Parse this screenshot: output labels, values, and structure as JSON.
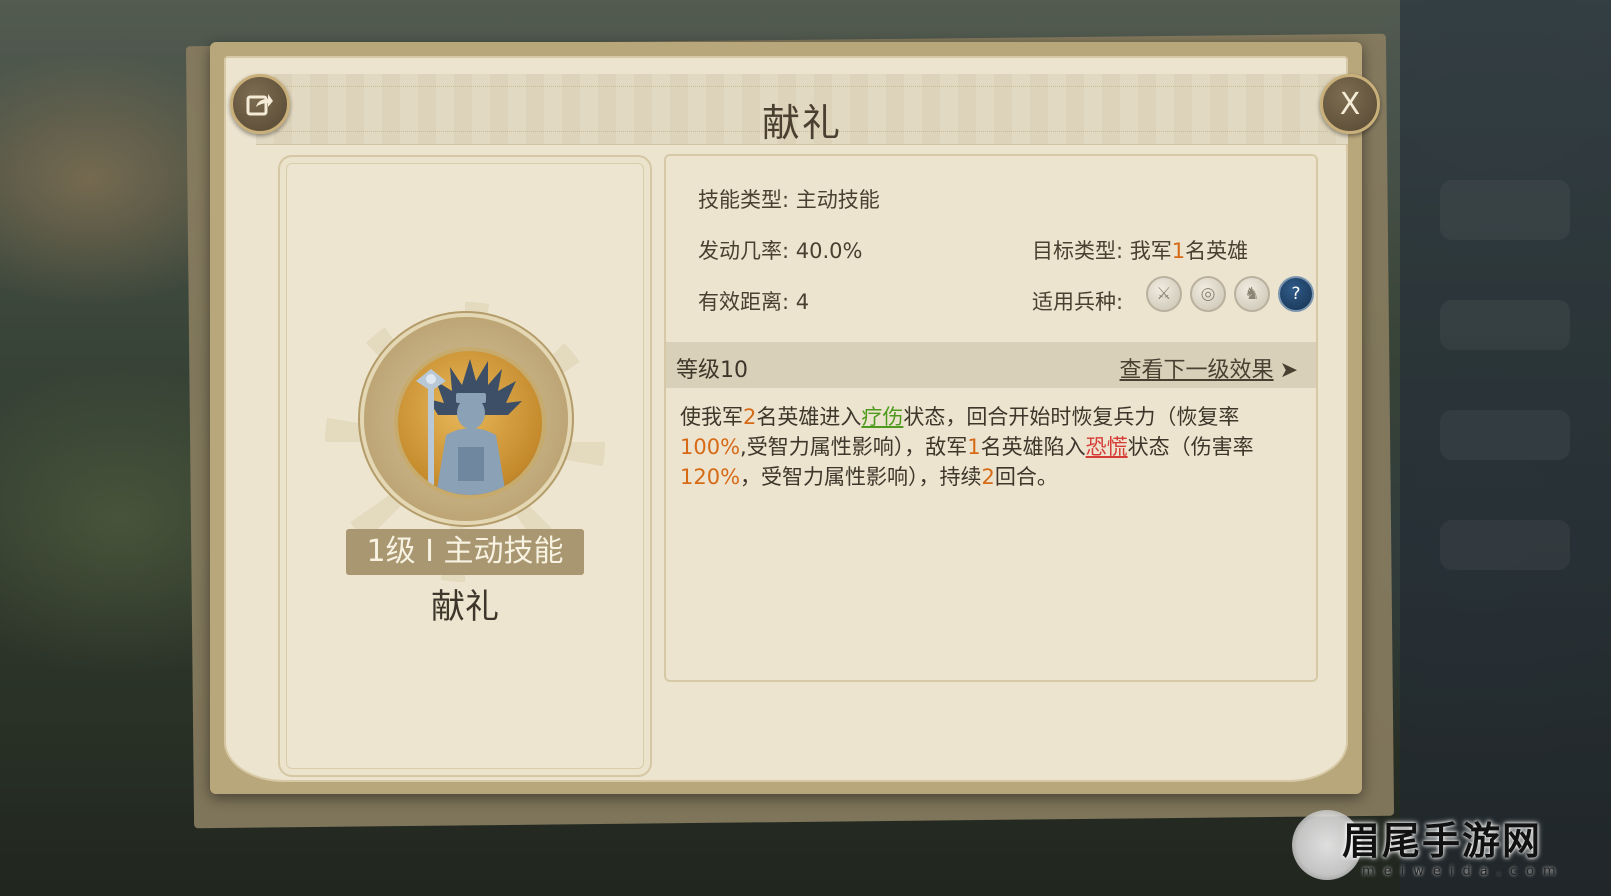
{
  "dialog": {
    "title": "献礼",
    "share_icon": "share-icon",
    "close_label": "X"
  },
  "skill_card": {
    "badge": "1级 I 主动技能",
    "name": "献礼"
  },
  "info": {
    "skill_type_label": "技能类型:",
    "skill_type_value": "主动技能",
    "trigger_rate_label": "发动几率:",
    "trigger_rate_value": "40.0%",
    "target_type_label": "目标类型:",
    "target_type_prefix": "我军",
    "target_type_count": "1",
    "target_type_suffix": "名英雄",
    "range_label": "有效距离:",
    "range_value": "4",
    "troop_label": "适用兵种:",
    "troop_icons": [
      "sword-icon",
      "target-icon",
      "horse-icon",
      "question-icon"
    ]
  },
  "level": {
    "label": "等级10",
    "next_link": "查看下一级效果"
  },
  "description": {
    "p1": "使我军",
    "n1": "2",
    "p2": "名英雄进入",
    "status1": "疗伤",
    "p3": "状态，回合开始时恢复兵力（恢复率",
    "n2": "100%",
    "p4": ",受智力属性影响），敌军",
    "n3": "1",
    "p5": "名英雄陷入",
    "status2": "恐慌",
    "p6": "状态（伤害率",
    "n4": "120%",
    "p7": "，受智力属性影响），持续",
    "n5": "2",
    "p8": "回合。"
  },
  "watermark": {
    "text": "眉尾手游网",
    "sub": "meiweida.com"
  },
  "colors": {
    "highlight_orange": "#d66a16",
    "highlight_green": "#4e9a1e",
    "highlight_red": "#d63b36"
  }
}
